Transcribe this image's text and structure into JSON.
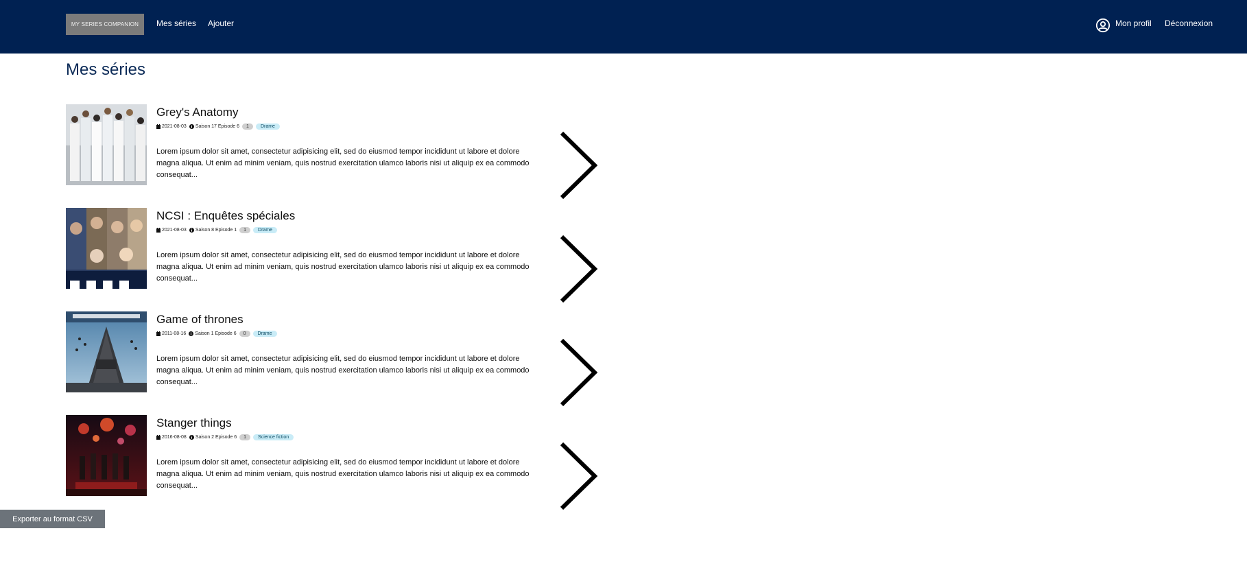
{
  "navbar": {
    "brand": "MY SERIES COMPANION",
    "links": [
      "Mes séries",
      "Ajouter"
    ],
    "profile_label": "Mon profil",
    "logout_label": "Déconnexion",
    "profile_icon": "user-circle-icon",
    "background": "#002152"
  },
  "page": {
    "title": "Mes séries"
  },
  "series": [
    {
      "title": "Grey's Anatomy",
      "date": "2021-08-03",
      "progress": "Saison 17 Episode 6",
      "count": "1",
      "genre": "Drame",
      "description": "Lorem ipsum dolor sit amet, consectetur adipisicing elit, sed do eiusmod tempor incididunt ut labore et dolore magna aliqua. Ut enim ad minim veniam, quis nostrud exercitation ulamco laboris nisi ut aliquip ex ea commodo consequat..."
    },
    {
      "title": "NCSI : Enquêtes spéciales",
      "date": "2021-08-03",
      "progress": "Saison 8 Episode 1",
      "count": "1",
      "genre": "Drame",
      "description": "Lorem ipsum dolor sit amet, consectetur adipisicing elit, sed do eiusmod tempor incididunt ut labore et dolore magna aliqua. Ut enim ad minim veniam, quis nostrud exercitation ulamco laboris nisi ut aliquip ex ea commodo consequat..."
    },
    {
      "title": "Game of thrones",
      "date": "2011-08-16",
      "progress": "Saison 1 Episode 6",
      "count": "0",
      "genre": "Drame",
      "description": "Lorem ipsum dolor sit amet, consectetur adipisicing elit, sed do eiusmod tempor incididunt ut labore et dolore magna aliqua. Ut enim ad minim veniam, quis nostrud exercitation ulamco laboris nisi ut aliquip ex ea commodo consequat..."
    },
    {
      "title": "Stanger things",
      "date": "2016-08-08",
      "progress": "Saison 2 Episode 6",
      "count": "1",
      "genre": "Science fiction",
      "description": "Lorem ipsum dolor sit amet, consectetur adipisicing elit, sed do eiusmod tempor incididunt ut labore et dolore magna aliqua. Ut enim ad minim veniam, quis nostrud exercitation ulamco laboris nisi ut aliquip ex ea commodo consequat..."
    }
  ],
  "footer": {
    "export_label": "Exporter au format CSV"
  },
  "icons": {
    "date": "calendar-icon",
    "progress": "info-circle-icon",
    "open": "chevron-right-icon"
  }
}
